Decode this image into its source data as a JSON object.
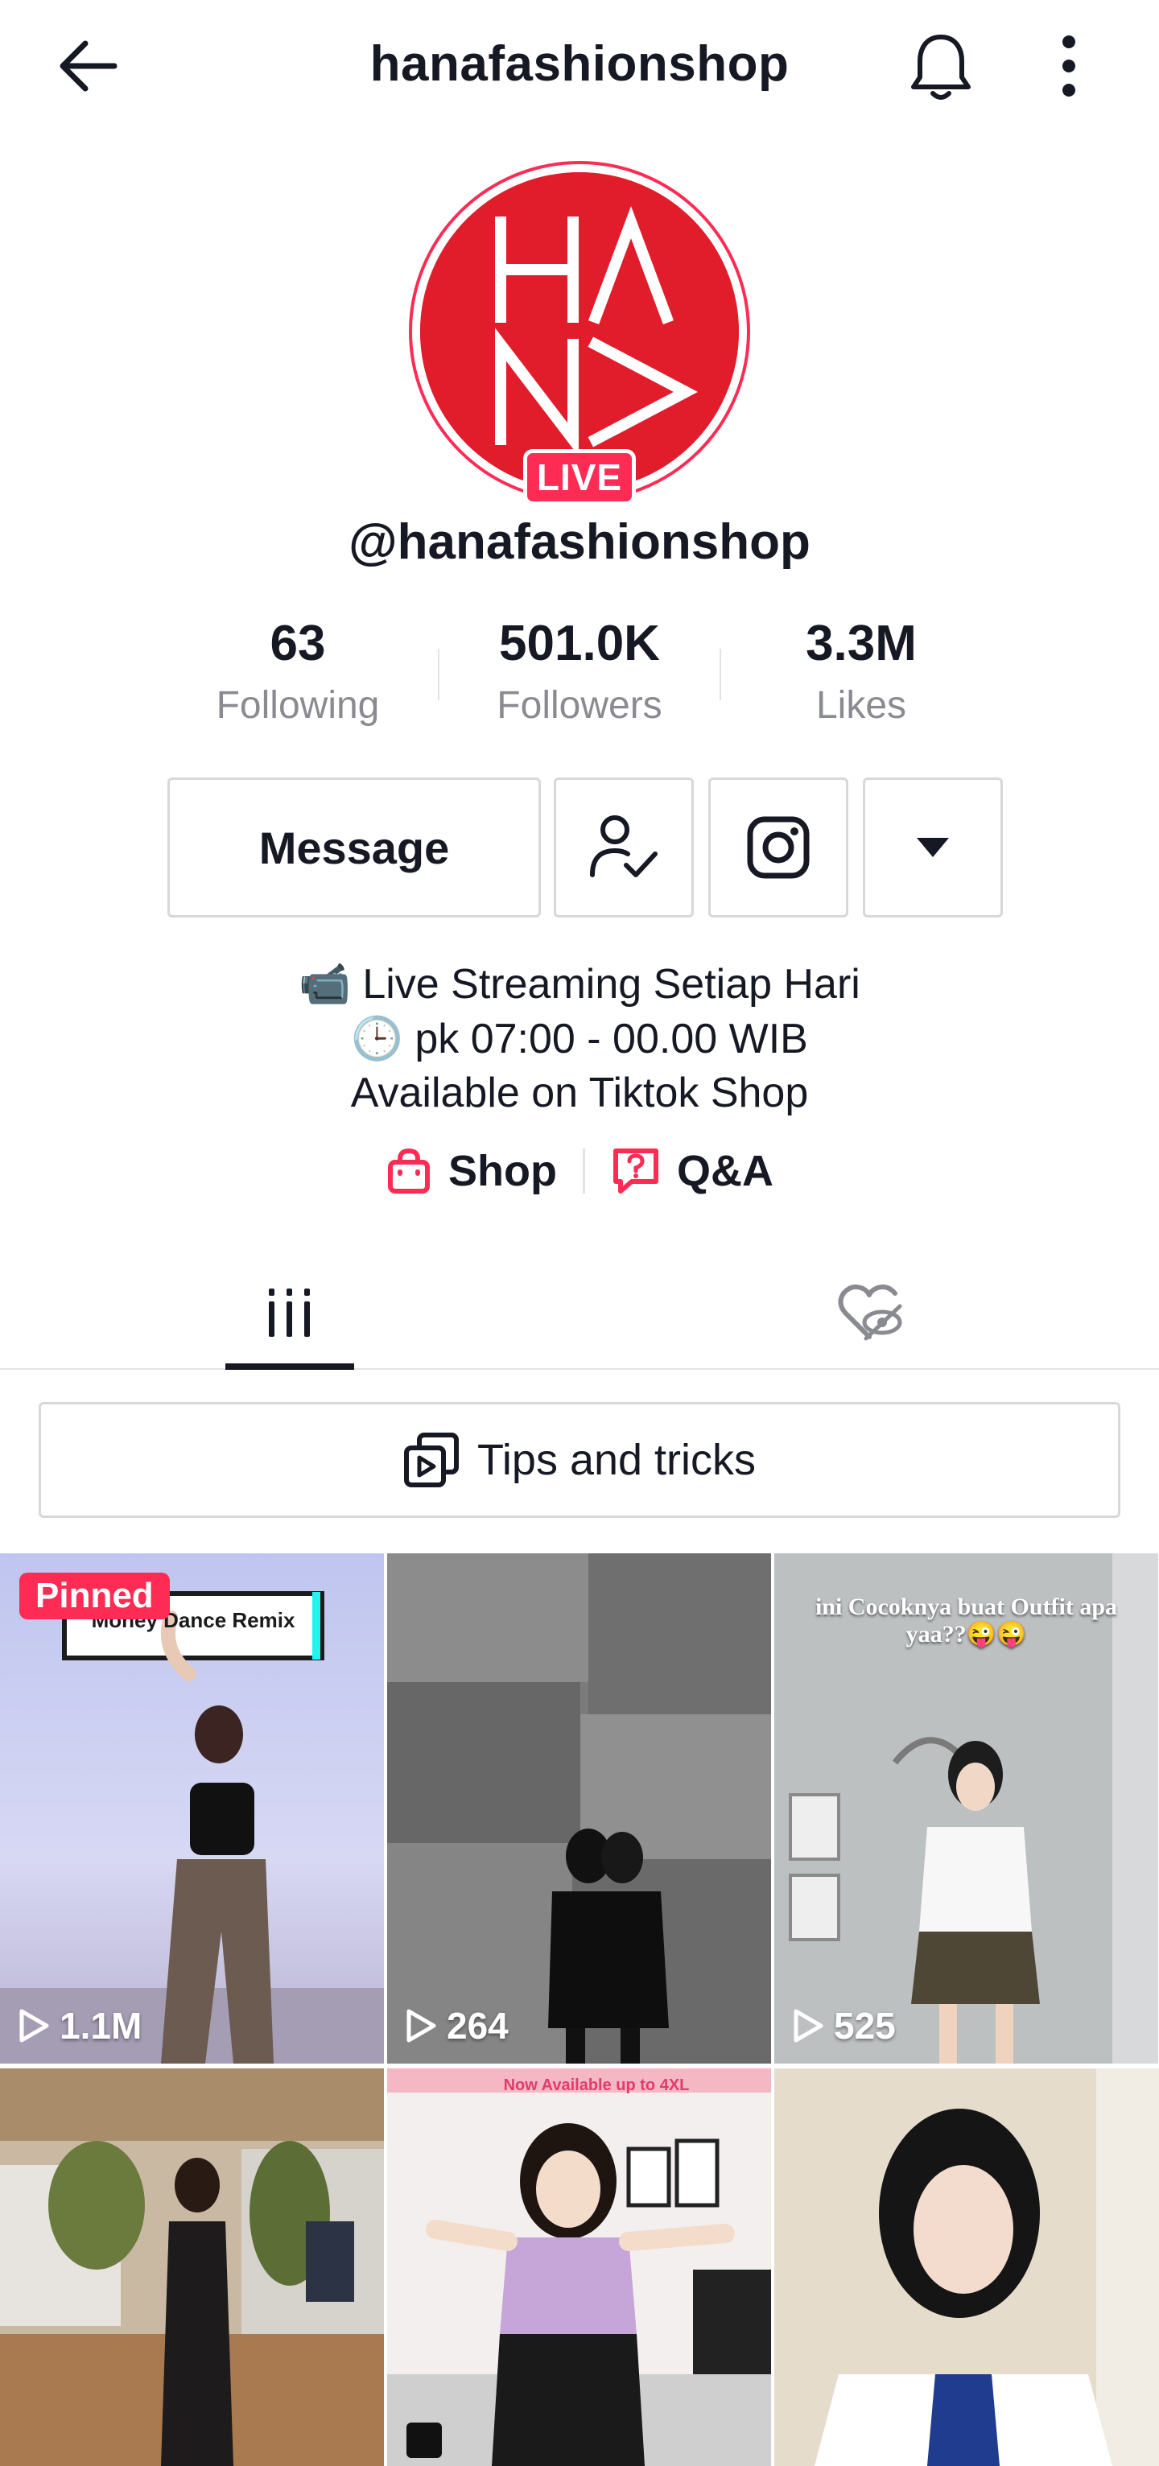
{
  "header": {
    "title": "hanafashionshop"
  },
  "profile": {
    "avatar_logo_text": "HANA",
    "live_badge": "LIVE",
    "username": "@hanafashionshop",
    "stats": [
      {
        "value": "63",
        "label": "Following"
      },
      {
        "value": "501.0K",
        "label": "Followers"
      },
      {
        "value": "3.3M",
        "label": "Likes"
      }
    ],
    "actions": {
      "message_label": "Message"
    },
    "bio": [
      "📹 Live Streaming Setiap Hari",
      "🕒 pk 07:00 - 00.00 WIB",
      "Available on Tiktok Shop"
    ],
    "links": {
      "shop": "Shop",
      "qa": "Q&A"
    }
  },
  "tips": {
    "label": "Tips and tricks"
  },
  "videos": [
    {
      "views": "1.1M",
      "badge": "Pinned",
      "caption": "Money Dance Remix"
    },
    {
      "views": "264"
    },
    {
      "views": "525",
      "caption": "ini Cocoknya buat Outfit apa yaa??😜😜"
    },
    {
      "views": ""
    },
    {
      "views": "",
      "caption": "Now Available up to 4XL"
    },
    {
      "views": ""
    }
  ],
  "colors": {
    "accent": "#fe2c55",
    "brand_red": "#e11d2c",
    "text": "#161823",
    "muted": "#8a8b91"
  }
}
